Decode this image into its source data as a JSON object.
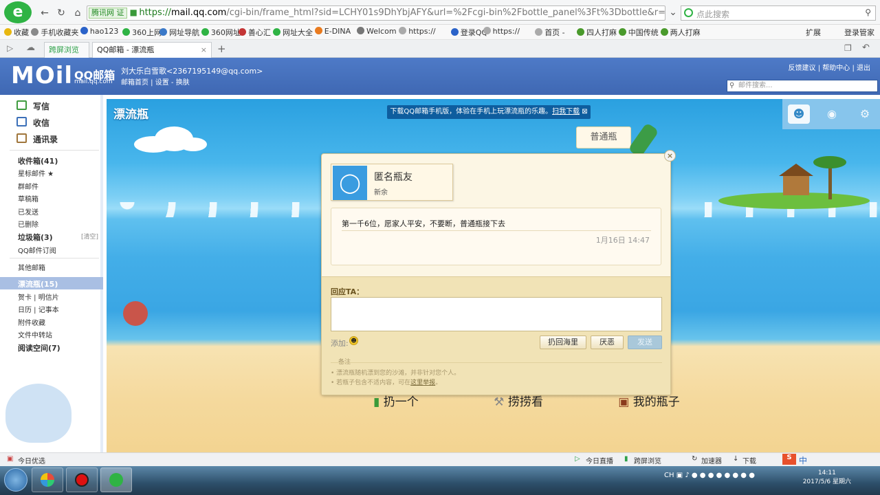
{
  "browser": {
    "site_badge": "腾讯网 证",
    "url_prefix": "https://",
    "url_host": "mail.qq.com",
    "url_path": "/cgi-bin/frame_html?sid=LCHY01s9DhYbjAFY&url=%2Fcgi-bin%2Fbottle_panel%3Ft%3Dbottle&r=629f(",
    "search_placeholder": "点此搜索",
    "favorites": [
      {
        "label": "收藏",
        "color": "#e8b70f"
      },
      {
        "label": "手机收藏夹",
        "color": "#8a8a8a"
      },
      {
        "label": "hao123",
        "color": "#2b63c9"
      },
      {
        "label": "360上网",
        "color": "#2fb344"
      },
      {
        "label": "网址导航",
        "color": "#3b79c8"
      },
      {
        "label": "360网址",
        "color": "#2fb344"
      },
      {
        "label": "善心汇",
        "color": "#c43535"
      },
      {
        "label": "网址大全",
        "color": "#2fb344"
      },
      {
        "label": "E-DINA",
        "color": "#e97b1f"
      },
      {
        "label": "Welcom",
        "color": "#777777"
      },
      {
        "label": "https://",
        "color": "#aaaaaa"
      },
      {
        "label": "登录QQ",
        "color": "#2b63c9"
      },
      {
        "label": "https://",
        "color": "#aaaaaa"
      },
      {
        "label": "首页 -",
        "color": "#aaaaaa"
      },
      {
        "label": "四人打麻",
        "color": "#4a9a2c"
      },
      {
        "label": "中国传统",
        "color": "#4a9a2c"
      },
      {
        "label": "两人打麻",
        "color": "#4a9a2c"
      }
    ],
    "fav_right": [
      "扩展",
      "登录管家"
    ],
    "tabs": [
      "跨屏浏览",
      "QQ邮箱 - 漂流瓶"
    ],
    "tab_close": "×",
    "new_tab": "+"
  },
  "header": {
    "logo": "MOil",
    "brand": "QQ邮箱",
    "brand_domain": "mail.qq.com",
    "user": "刘大乐白雪歌<2367195149@qq.com>",
    "user_links": "邮箱首页 | 设置 - 换肤",
    "top_links": "反馈建议 | 帮助中心 | 退出",
    "search_placeholder": "邮件搜索..."
  },
  "sidebar": {
    "compose": "写信",
    "inbox_main": "收信",
    "contacts": "通讯录",
    "items": [
      {
        "label": "收件箱(41)",
        "bold": true
      },
      {
        "label": "星标邮件 ★",
        "bold": false
      },
      {
        "label": "群邮件",
        "bold": false
      },
      {
        "label": "草稿箱",
        "bold": false
      },
      {
        "label": "已发送",
        "bold": false
      },
      {
        "label": "已删除",
        "bold": false
      },
      {
        "label": "垃圾箱(3)",
        "bold": true
      },
      {
        "label": "QQ邮件订阅",
        "bold": false
      },
      {
        "label": "其他邮箱",
        "bold": false
      },
      {
        "label": "漂流瓶(15)",
        "bold": true
      },
      {
        "label": "贺卡 | 明信片",
        "bold": false
      },
      {
        "label": "日历 | 记事本",
        "bold": false
      },
      {
        "label": "附件收藏",
        "bold": false
      },
      {
        "label": "文件中转站",
        "bold": false
      },
      {
        "label": "阅读空间(7)",
        "bold": true
      }
    ],
    "clear_label": "[清空]"
  },
  "content": {
    "page_title": "漂流瓶",
    "notice": "下载QQ邮箱手机版，体验在手机上玩漂流瓶的乐趣。",
    "notice_link": "扫我下载",
    "normal_bottle": "普通瓶",
    "actions": [
      "扔一个",
      "捞捞看",
      "我的瓶子"
    ]
  },
  "dialog": {
    "close": "×",
    "sender_name": "匿名瓶友",
    "sender_location": "新余",
    "message": "第一千6位，愿家人平安，不要断，普通瓶接下去",
    "timestamp": "1月16日 14:47",
    "reply_label": "回应TA：",
    "reply_value": "",
    "add_label": "添加:",
    "btn_throwback": "扔回海里",
    "btn_dislike": "厌恶",
    "btn_send": "发送",
    "note_header": "备注",
    "notes": [
      "漂流瓶随机漂到您的沙滩，并非针对您个人。",
      "若瓶子包含不适内容，可在这里举报。"
    ],
    "note_link": "这里举报"
  },
  "statusbar": {
    "left": "今日优选",
    "items": [
      "今日直播",
      "跨屏浏览",
      "加速器",
      "下载"
    ],
    "ime": "中"
  },
  "taskbar": {
    "time": "14:11",
    "date": "2017/5/6 星期六",
    "tray_lang": "CH"
  }
}
